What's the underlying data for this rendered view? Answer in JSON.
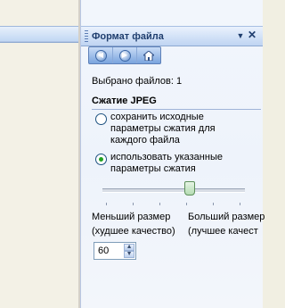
{
  "pane": {
    "title": "Формат файла",
    "dropdown_glyph": "▼",
    "close_glyph": "✕"
  },
  "nav": {
    "back_icon": "back-arrow-icon",
    "forward_icon": "forward-arrow-icon",
    "home_icon": "home-icon"
  },
  "selected_files": "Выбрано файлов: 1",
  "jpeg": {
    "section_title": "Сжатие JPEG",
    "option_keep": "сохранить исходные\nпараметры сжатия для\nкаждого файла",
    "option_use": "использовать указанные\nпараметры сжатия",
    "selected_option": "option_use",
    "slider_level": 60,
    "label_small": "Меньший размер",
    "label_large": "Больший размер",
    "label_small_quality": "(худшее качество)",
    "label_large_quality": "(лучшее качест",
    "quality_value": "60"
  },
  "colors": {
    "accent": "#21a121",
    "title_text": "#1f3e6e"
  }
}
